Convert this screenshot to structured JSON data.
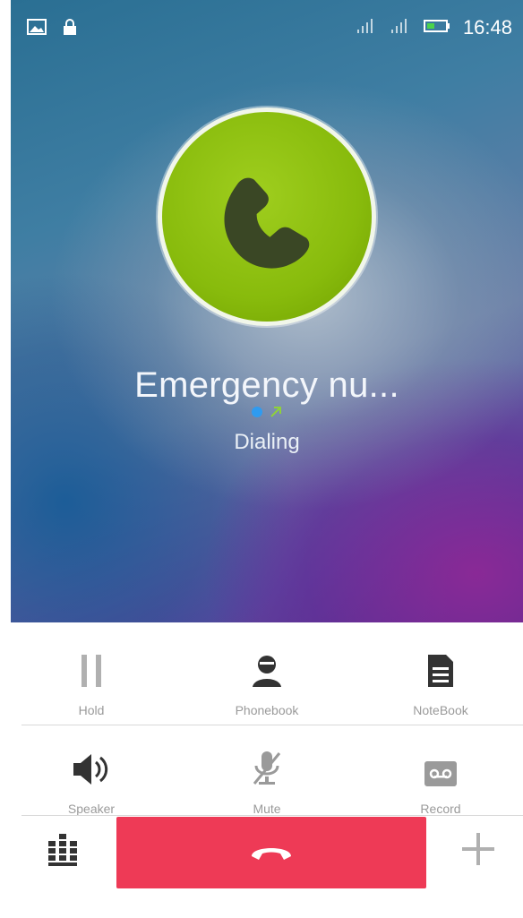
{
  "status_bar": {
    "time": "16:48",
    "left_icons": [
      "image-notification-icon",
      "lock-icon"
    ],
    "right_icons": [
      "signal-sim1-icon",
      "signal-sim2-icon",
      "battery-icon"
    ]
  },
  "call": {
    "name": "Emergency nu...",
    "state": "Dialing",
    "direction_icons": [
      "sim-dot-icon",
      "outgoing-arrow-icon"
    ],
    "avatar_icon": "phone-handset-icon"
  },
  "controls": {
    "row1": [
      {
        "label": "Hold",
        "icon": "pause-icon"
      },
      {
        "label": "Phonebook",
        "icon": "contact-icon"
      },
      {
        "label": "NoteBook",
        "icon": "note-icon"
      }
    ],
    "row2": [
      {
        "label": "Speaker",
        "icon": "speaker-icon"
      },
      {
        "label": "Mute",
        "icon": "mute-mic-icon"
      },
      {
        "label": "Record",
        "icon": "record-icon"
      }
    ]
  },
  "bottom": {
    "end_call_icon": "end-call-icon",
    "keypad_icon": "dialpad-icon",
    "add_icon": "add-call-icon"
  },
  "colors": {
    "accent_green": "#88bb0c",
    "end_call_red": "#ee3a56",
    "label_gray": "#9a9a9a"
  }
}
